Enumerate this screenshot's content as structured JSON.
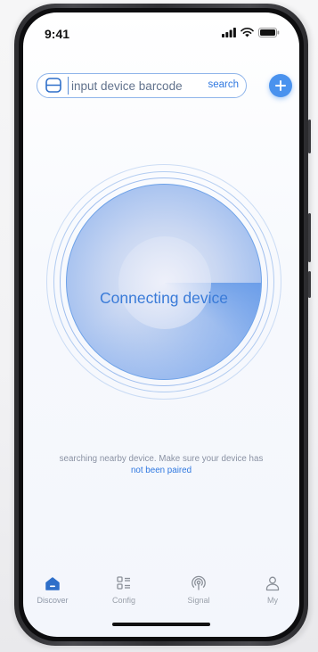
{
  "status_bar": {
    "time": "9:41"
  },
  "search": {
    "placeholder": "input device barcode",
    "button_label": "search",
    "scan_icon": "barcode-scan-icon",
    "add_icon": "plus-icon"
  },
  "radar": {
    "status_text": "Connecting device"
  },
  "hint": {
    "text": "searching nearby device. Make sure your device has",
    "link_text": "not been paired"
  },
  "tabs": [
    {
      "label": "Discover",
      "icon": "home-icon",
      "active": true
    },
    {
      "label": "Config",
      "icon": "config-grid-icon",
      "active": false
    },
    {
      "label": "Signal",
      "icon": "signal-icon",
      "active": false
    },
    {
      "label": "My",
      "icon": "person-icon",
      "active": false
    }
  ],
  "colors": {
    "accent": "#4a92ee",
    "link": "#2f78e0",
    "radar_text": "#3a7bd8",
    "tab_label": "#9aa0aa"
  }
}
